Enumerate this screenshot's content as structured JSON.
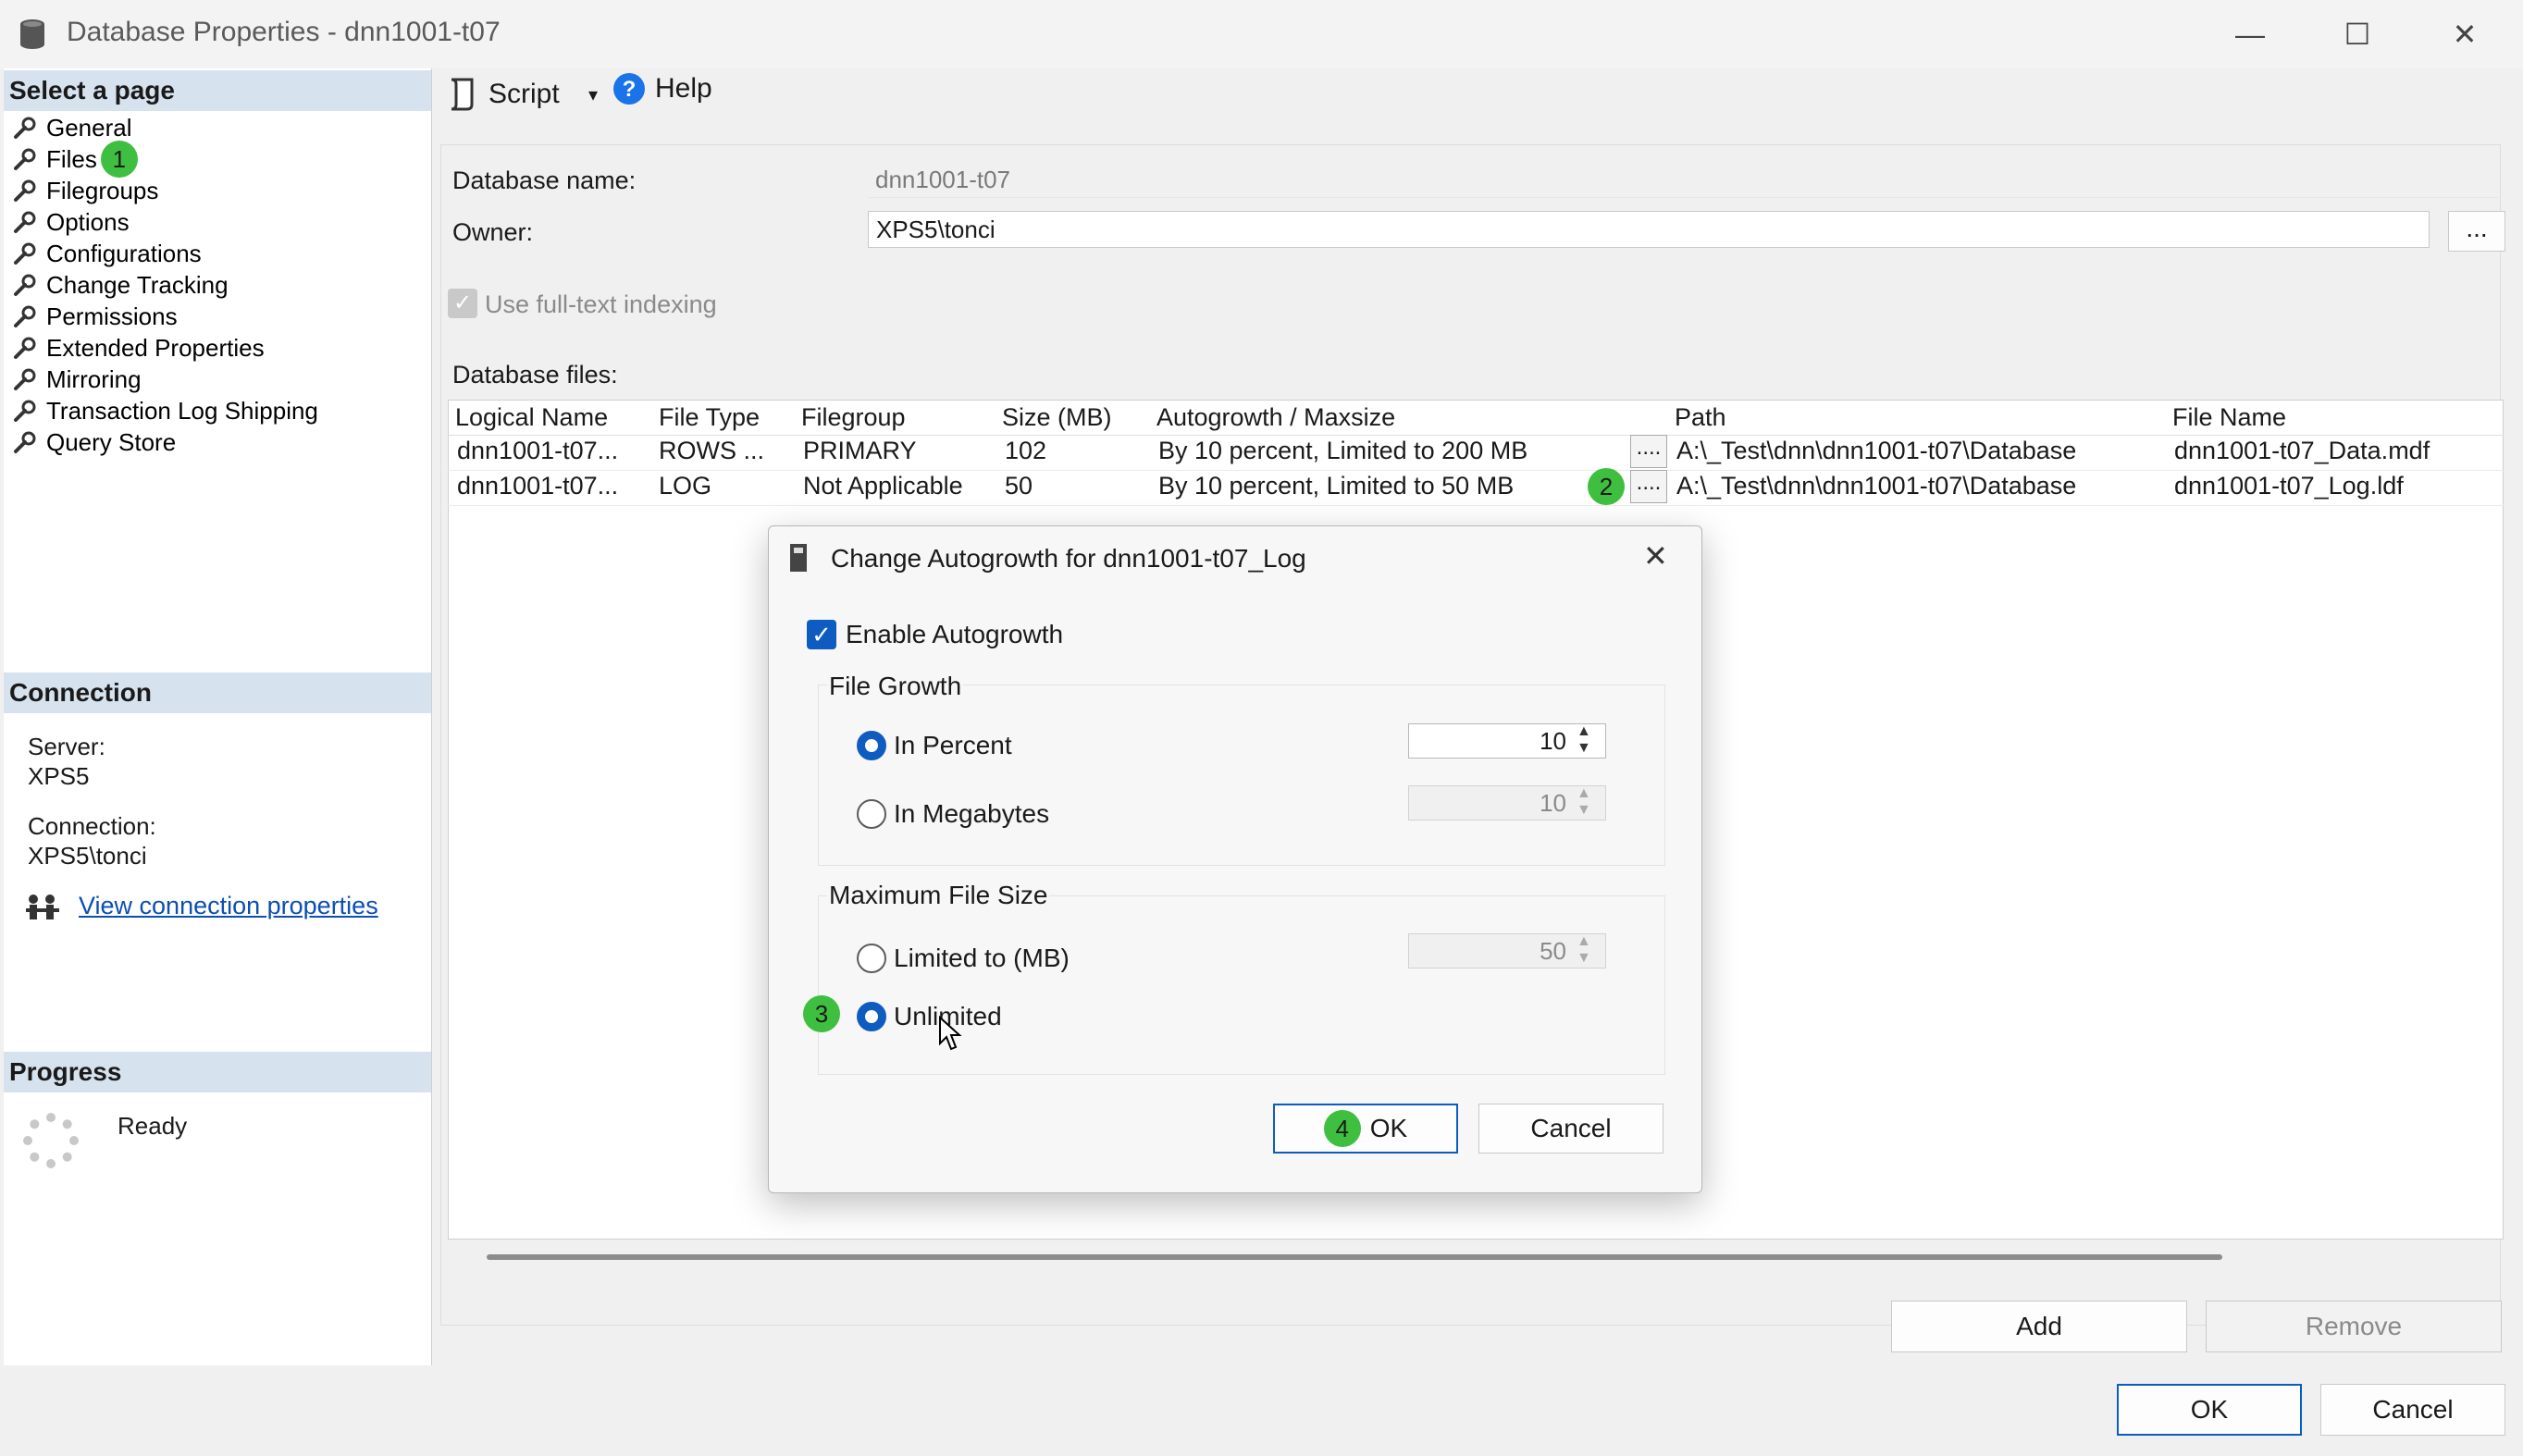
{
  "window": {
    "title": "Database Properties - dnn1001-t07",
    "icon": "database-icon",
    "controls": [
      "minimize-icon",
      "maximize-icon",
      "close-icon"
    ]
  },
  "left_panel": {
    "select_page_header": "Select a page",
    "pages": [
      {
        "label": "General"
      },
      {
        "label": "Files",
        "step": "1"
      },
      {
        "label": "Filegroups"
      },
      {
        "label": "Options"
      },
      {
        "label": "Configurations"
      },
      {
        "label": "Change Tracking"
      },
      {
        "label": "Permissions"
      },
      {
        "label": "Extended Properties"
      },
      {
        "label": "Mirroring"
      },
      {
        "label": "Transaction Log Shipping"
      },
      {
        "label": "Query Store"
      }
    ],
    "connection_header": "Connection",
    "server_label": "Server:",
    "server_value": "XPS5",
    "connection_label": "Connection:",
    "connection_value": "XPS5\\tonci",
    "view_connection_link": "View connection properties",
    "progress_header": "Progress",
    "progress_status": "Ready"
  },
  "toolbar": {
    "script_label": "Script",
    "help_label": "Help"
  },
  "form": {
    "database_name_label": "Database name:",
    "database_name_value": "dnn1001-t07",
    "owner_label": "Owner:",
    "owner_value": "XPS5\\tonci",
    "owner_browse_label": "...",
    "fulltext_label": "Use full-text indexing",
    "fulltext_checked": true,
    "database_files_label": "Database files:"
  },
  "files_table": {
    "columns": [
      "Logical Name",
      "File Type",
      "Filegroup",
      "Size (MB)",
      "Autogrowth / Maxsize",
      "Path",
      "File Name"
    ],
    "rows": [
      {
        "logical_name": "dnn1001-t07...",
        "file_type": "ROWS ...",
        "filegroup": "PRIMARY",
        "size": "102",
        "autogrowth": "By 10 percent, Limited to 200 MB",
        "button": "....",
        "path": "A:\\_Test\\dnn\\dnn1001-t07\\Database",
        "file_name": "dnn1001-t07_Data.mdf"
      },
      {
        "logical_name": "dnn1001-t07...",
        "file_type": "LOG",
        "filegroup": "Not Applicable",
        "size": "50",
        "autogrowth": "By 10 percent, Limited to 50 MB",
        "button": "....",
        "step": "2",
        "path": "A:\\_Test\\dnn\\dnn1001-t07\\Database",
        "file_name": "dnn1001-t07_Log.ldf"
      }
    ]
  },
  "buttons": {
    "add": "Add",
    "remove": "Remove",
    "ok": "OK",
    "cancel": "Cancel"
  },
  "dialog": {
    "title": "Change Autogrowth for dnn1001-t07_Log",
    "enable_autogrowth_label": "Enable Autogrowth",
    "enable_autogrowth_checked": true,
    "file_growth_header": "File Growth",
    "in_percent_label": "In Percent",
    "in_percent_value": "10",
    "in_megabytes_label": "In Megabytes",
    "in_megabytes_value": "10",
    "file_growth_selected": "In Percent",
    "max_file_size_header": "Maximum File Size",
    "limited_label": "Limited to (MB)",
    "limited_value": "50",
    "unlimited_label": "Unlimited",
    "unlimited_step": "3",
    "max_size_selected": "Unlimited",
    "ok_label": "OK",
    "ok_step": "4",
    "cancel_label": "Cancel"
  },
  "colors": {
    "accent": "#0f5cc0",
    "step_badge": "#3fbf3f",
    "section_header": "#d7e2ef",
    "link": "#0b4fb3"
  }
}
